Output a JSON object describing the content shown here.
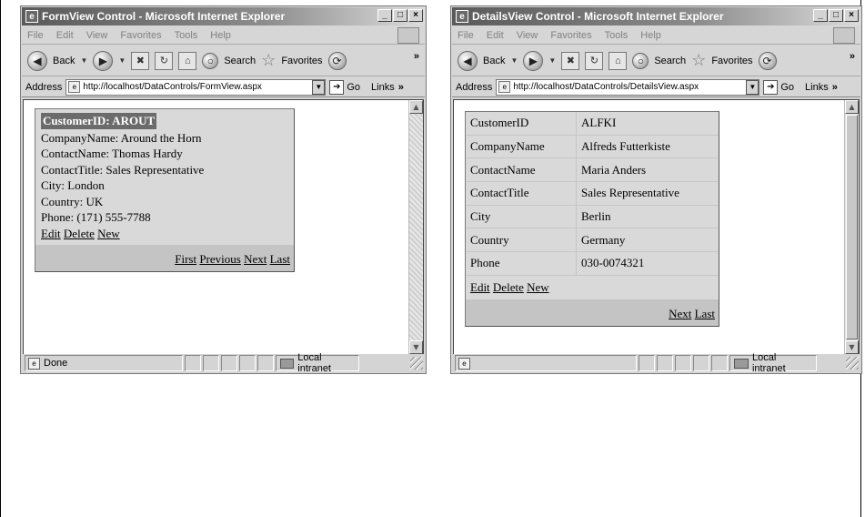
{
  "left_window": {
    "title": "FormView Control - Microsoft Internet Explorer",
    "menu": [
      "File",
      "Edit",
      "View",
      "Favorites",
      "Tools",
      "Help"
    ],
    "toolbar": {
      "back": "Back",
      "search": "Search",
      "favorites": "Favorites",
      "more": "»"
    },
    "address": {
      "label": "Address",
      "url": "http://localhost/DataControls/FormView.aspx",
      "go": "Go",
      "links": "Links",
      "more": "»"
    },
    "status": {
      "text": "Done",
      "zone": "Local intranet"
    },
    "formview": {
      "header": "CustomerID: AROUT",
      "fields": [
        "CompanyName: Around the Horn",
        "ContactName: Thomas Hardy",
        "ContactTitle: Sales Representative",
        "City: London",
        "Country: UK",
        "Phone: (171) 555-7788"
      ],
      "commands": [
        "Edit",
        "Delete",
        "New"
      ],
      "pager": [
        "First",
        "Previous",
        "Next",
        "Last"
      ]
    }
  },
  "right_window": {
    "title": "DetailsView Control - Microsoft Internet Explorer",
    "menu": [
      "File",
      "Edit",
      "View",
      "Favorites",
      "Tools",
      "Help"
    ],
    "toolbar": {
      "back": "Back",
      "search": "Search",
      "favorites": "Favorites",
      "more": "»"
    },
    "address": {
      "label": "Address",
      "url": "http://localhost/DataControls/DetailsView.aspx",
      "go": "Go",
      "links": "Links",
      "more": "»"
    },
    "status": {
      "text": "",
      "zone": "Local intranet"
    },
    "detailsview": {
      "rows": [
        {
          "key": "CustomerID",
          "value": "ALFKI"
        },
        {
          "key": "CompanyName",
          "value": "Alfreds Futterkiste"
        },
        {
          "key": "ContactName",
          "value": "Maria Anders"
        },
        {
          "key": "ContactTitle",
          "value": "Sales Representative"
        },
        {
          "key": "City",
          "value": "Berlin"
        },
        {
          "key": "Country",
          "value": "Germany"
        },
        {
          "key": "Phone",
          "value": "030-0074321"
        }
      ],
      "commands": [
        "Edit",
        "Delete",
        "New"
      ],
      "pager": [
        "Next",
        "Last"
      ]
    }
  },
  "colors": {
    "header_bg": "#6b6b6b",
    "control_bg": "#d9d9d9",
    "pager_bg": "#c4c4c4"
  }
}
